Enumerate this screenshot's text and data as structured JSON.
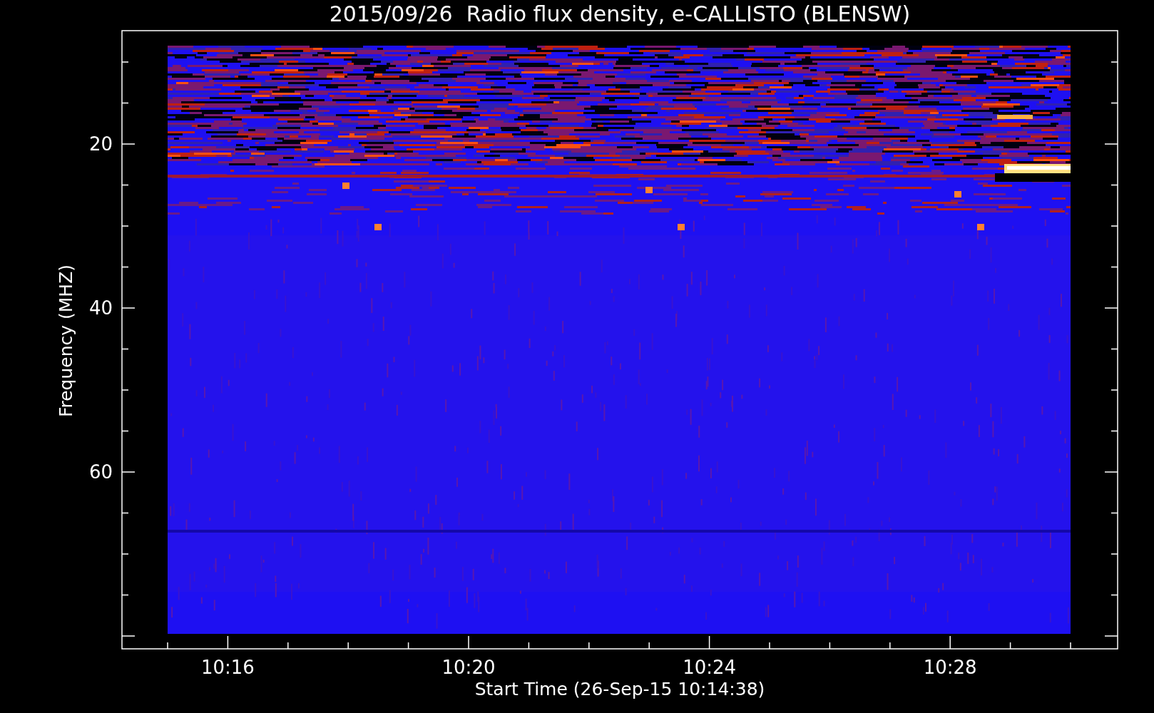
{
  "title": "2015/09/26  Radio flux density, e-CALLISTO (BLENSW)",
  "y_axis": {
    "title": "Frequency (MHZ)",
    "tick_labels": [
      "20",
      "40",
      "60"
    ]
  },
  "x_axis": {
    "title": "Start Time (26-Sep-15 10:14:38)",
    "tick_labels": [
      "10:16",
      "10:20",
      "10:24",
      "10:28"
    ]
  }
}
